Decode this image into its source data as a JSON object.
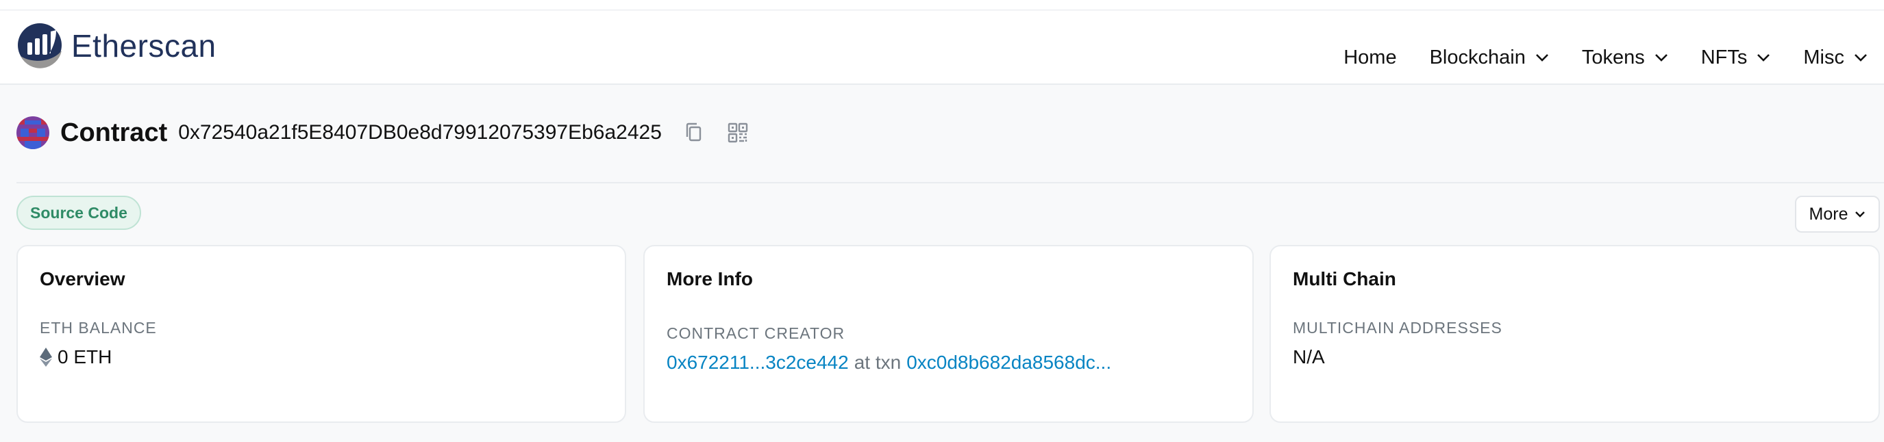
{
  "header": {
    "logo_text": "Etherscan",
    "nav": [
      {
        "label": "Home",
        "dropdown": false
      },
      {
        "label": "Blockchain",
        "dropdown": true
      },
      {
        "label": "Tokens",
        "dropdown": true
      },
      {
        "label": "NFTs",
        "dropdown": true
      },
      {
        "label": "Misc",
        "dropdown": true
      }
    ]
  },
  "page": {
    "title": "Contract",
    "address": "0x72540a21f5E8407DB0e8d79912075397Eb6a2425",
    "icons": [
      "copy-icon",
      "qr-code-icon"
    ]
  },
  "badge": {
    "label": "Source Code"
  },
  "more_button": {
    "label": "More"
  },
  "cards": {
    "overview": {
      "title": "Overview",
      "label": "ETH BALANCE",
      "value": "0 ETH"
    },
    "more_info": {
      "title": "More Info",
      "label": "CONTRACT CREATOR",
      "creator": "0x672211...3c2ce442",
      "at_txn": "at txn",
      "txn": "0xc0d8b682da8568dc..."
    },
    "multi_chain": {
      "title": "Multi Chain",
      "label": "MULTICHAIN ADDRESSES",
      "value": "N/A"
    }
  },
  "colors": {
    "brand": "#21325b",
    "link": "#0784c3",
    "badge_text": "#2f8b66",
    "badge_bg": "#e8f5ef",
    "page_bg": "#f8f9fa"
  }
}
